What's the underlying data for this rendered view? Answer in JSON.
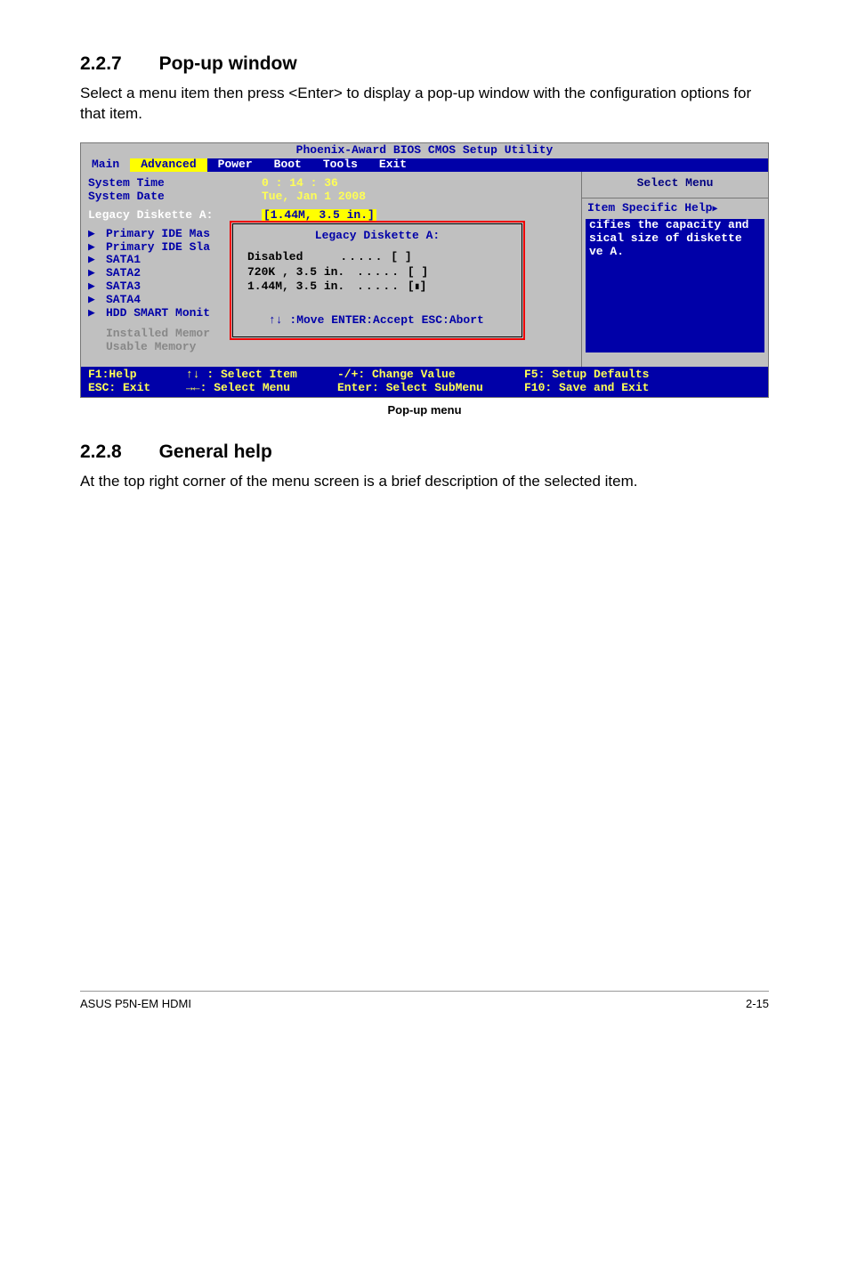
{
  "sections": {
    "s1_num": "2.2.7",
    "s1_title": "Pop-up window",
    "s1_body": "Select a menu item then press <Enter> to display a pop-up window with the configuration options for that item.",
    "s2_num": "2.2.8",
    "s2_title": "General help",
    "s2_body": "At the top right corner of the menu screen is a brief description of the selected item."
  },
  "bios": {
    "utility_title": "Phoenix-Award BIOS CMOS Setup Utility",
    "tabs": {
      "main": "Main",
      "advanced": "Advanced",
      "power": "Power",
      "boot": "Boot",
      "tools": "Tools",
      "exit": "Exit"
    },
    "system_time_label": "System Time",
    "system_time_value": "0 : 14 : 36",
    "system_date_label": "System Date",
    "system_date_value": "Tue, Jan  1 2008",
    "legacy_label": "Legacy Diskette A:",
    "legacy_value": "[1.44M, 3.5 in.]",
    "subitems": {
      "pim": "Primary IDE Mas",
      "pis": "Primary IDE Sla",
      "sata1": "SATA1",
      "sata2": "SATA2",
      "sata3": "SATA3",
      "sata4": "SATA4",
      "hdd": "HDD SMART Monit"
    },
    "installed_label": "Installed Memor",
    "usable_label": "Usable Memory",
    "popup_title": "Legacy Diskette A:",
    "popup_opt1": "Disabled",
    "popup_opt2": "720K , 3.5 in.",
    "popup_opt3": "1.44M, 3.5 in.",
    "popup_nav": "↑↓ :Move  ENTER:Accept  ESC:Abort",
    "right_title": "Select Menu",
    "right_help_header": "Item Specific Help",
    "right_help_body": "cifies the capacity and sical size of diskette ve A.",
    "keys": {
      "f1": "F1:Help",
      "esc": "ESC: Exit",
      "sel_item": "↑↓ : Select Item",
      "sel_menu": "→←: Select Menu",
      "chg": "-/+: Change Value",
      "sub": "Enter: Select SubMenu",
      "f5": "F5: Setup Defaults",
      "f10": "F10: Save and Exit"
    }
  },
  "caption": "Pop-up menu",
  "footer_left": "ASUS P5N-EM HDMI",
  "footer_right": "2-15"
}
